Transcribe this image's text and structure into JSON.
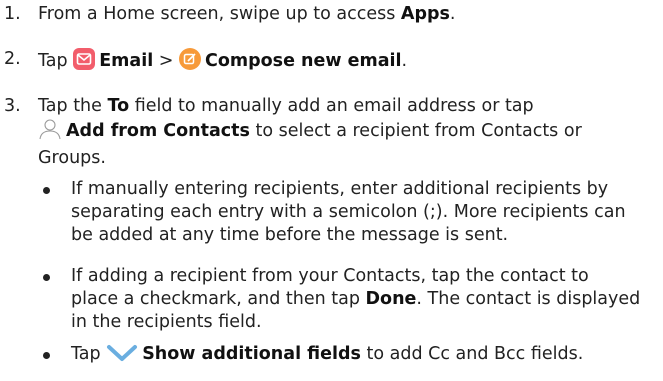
{
  "steps": [
    {
      "num": "1.",
      "pre": "From a Home screen, swipe up to access ",
      "bold": "Apps",
      "post": "."
    },
    {
      "num": "2.",
      "pre": "Tap ",
      "email": "Email",
      "sep": " > ",
      "compose": "Compose new email",
      "post": "."
    },
    {
      "num": "3.",
      "pre": "Tap the ",
      "to": "To",
      "mid": " field to manually add an email address or tap",
      "add": "Add from Contacts",
      "post1": " to select a recipient from Contacts or",
      "post2": "Groups."
    }
  ],
  "bullets": [
    {
      "lines": [
        "If manually entering recipients, enter additional recipients by",
        "separating each entry with a semicolon (;). More recipients can",
        "be added at any time before the message is sent."
      ]
    },
    {
      "l1": "If adding a recipient from your Contacts, tap the contact to",
      "l2pre": "place a checkmark, and then tap ",
      "l2bold": "Done",
      "l2post": ". The contact is displayed",
      "l3": "in the recipients field."
    },
    {
      "pre": "Tap ",
      "bold": "Show additional fields",
      "post": " to add Cc and Bcc fields."
    }
  ],
  "icons": {
    "email": "email-app-icon",
    "compose": "compose-icon",
    "contact": "contact-person-icon",
    "chevron": "chevron-down-icon"
  },
  "colors": {
    "email_icon": "#f25d6b",
    "compose_icon": "#f79a3a",
    "chevron": "#6aaee0",
    "contact_icon": "#9a9a9a"
  }
}
